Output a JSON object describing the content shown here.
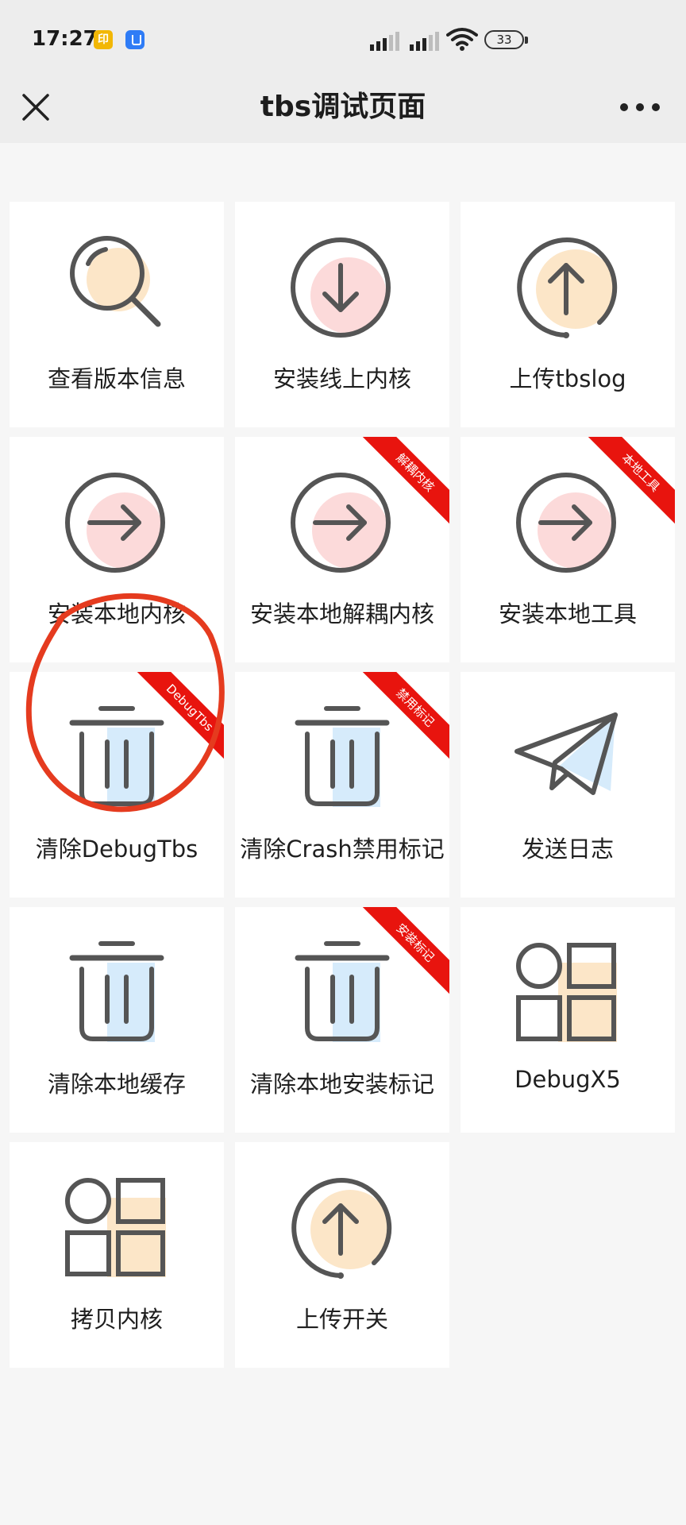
{
  "status_bar": {
    "time": "17:27",
    "app_icon_1": "印",
    "battery": "33"
  },
  "header": {
    "title": "tbs调试页面",
    "close_icon": "close-icon",
    "more_icon": "more-icon"
  },
  "tiles": [
    {
      "label": "查看版本信息",
      "icon": "search-icon",
      "ribbon": ""
    },
    {
      "label": "安装线上内核",
      "icon": "download-icon",
      "ribbon": ""
    },
    {
      "label": "上传tbslog",
      "icon": "upload-icon",
      "ribbon": ""
    },
    {
      "label": "安装本地内核",
      "icon": "arrow-right-icon",
      "ribbon": ""
    },
    {
      "label": "安装本地解耦内核",
      "icon": "arrow-right-icon",
      "ribbon": "解耦内核"
    },
    {
      "label": "安装本地工具",
      "icon": "arrow-right-icon",
      "ribbon": "本地工具"
    },
    {
      "label": "清除DebugTbs",
      "icon": "trash-icon",
      "ribbon": "DebugTbs"
    },
    {
      "label": "清除Crash禁用标记",
      "icon": "trash-icon",
      "ribbon": "禁用标记"
    },
    {
      "label": "发送日志",
      "icon": "send-icon",
      "ribbon": ""
    },
    {
      "label": "清除本地缓存",
      "icon": "trash-icon",
      "ribbon": ""
    },
    {
      "label": "清除本地安装标记",
      "icon": "trash-icon",
      "ribbon": "安装标记"
    },
    {
      "label": "DebugX5",
      "icon": "grid-icon",
      "ribbon": ""
    },
    {
      "label": "拷贝内核",
      "icon": "grid-icon",
      "ribbon": ""
    },
    {
      "label": "上传开关",
      "icon": "upload-icon",
      "ribbon": ""
    }
  ],
  "colors": {
    "ribbon": "#e8140e",
    "annotation": "#e53b1f",
    "icon_stroke": "#555555",
    "accent_peach": "#fce6c8",
    "accent_pink": "#fcdada",
    "accent_blue": "#d6ebfb"
  }
}
